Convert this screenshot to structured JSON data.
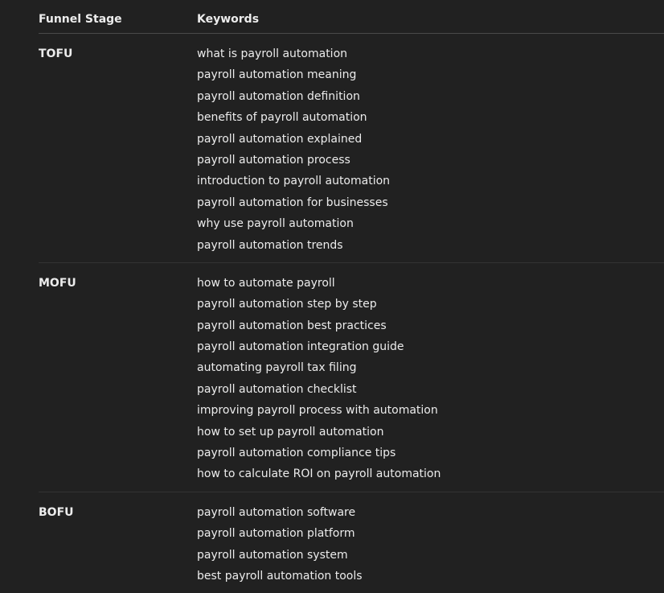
{
  "header": {
    "stage_label": "Funnel Stage",
    "keywords_label": "Keywords"
  },
  "sections": [
    {
      "stage": "TOFU",
      "keywords": [
        "what is payroll automation",
        "payroll automation meaning",
        "payroll automation definition",
        "benefits of payroll automation",
        "payroll automation explained",
        "payroll automation process",
        "introduction to payroll automation",
        "payroll automation for businesses",
        "why use payroll automation",
        "payroll automation trends"
      ]
    },
    {
      "stage": "MOFU",
      "keywords": [
        "how to automate payroll",
        "payroll automation step by step",
        "payroll automation best practices",
        "payroll automation integration guide",
        "automating payroll tax filing",
        "payroll automation checklist",
        "improving payroll process with automation",
        "how to set up payroll automation",
        "payroll automation compliance tips",
        "how to calculate ROI on payroll automation"
      ]
    },
    {
      "stage": "BOFU",
      "keywords": [
        "payroll automation software",
        "payroll automation platform",
        "payroll automation system",
        "best payroll automation tools"
      ]
    }
  ]
}
